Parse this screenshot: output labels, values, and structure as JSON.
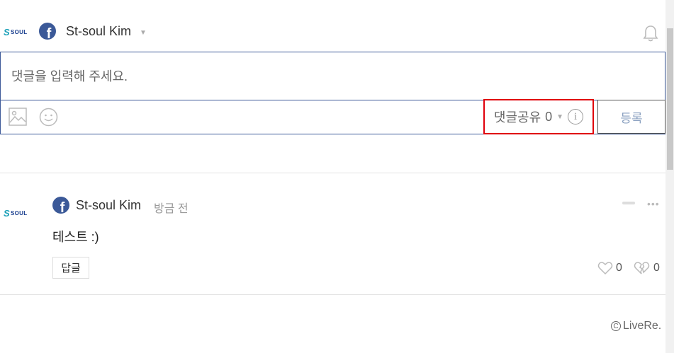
{
  "header": {
    "logo_text": "SOUL",
    "user_name": "St-soul Kim"
  },
  "composer": {
    "placeholder": "댓글을 입력해 주세요.",
    "share_label": "댓글공유",
    "share_count": "0",
    "submit_label": "등록"
  },
  "comments": [
    {
      "author": "St-soul Kim",
      "time": "방금 전",
      "text": "테스트 :)",
      "reply_label": "답글",
      "likes": "0",
      "dislikes": "0"
    }
  ],
  "footer": {
    "brand": "LiveRe."
  },
  "colors": {
    "accent_border": "#3d5a99",
    "highlight": "#e0000b",
    "facebook": "#3b5998"
  }
}
